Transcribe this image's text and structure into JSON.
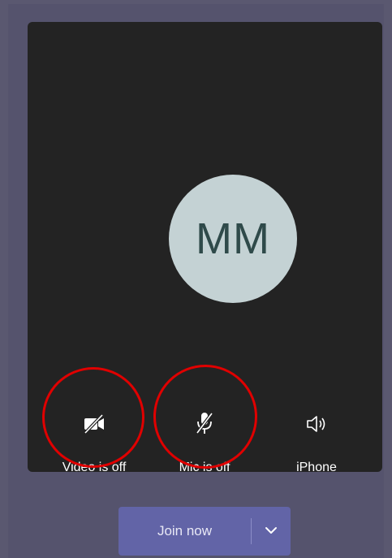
{
  "preview": {
    "avatar_initials": "MM"
  },
  "controls": {
    "video": {
      "label": "Video is off",
      "icon": "video-off-icon"
    },
    "mic": {
      "label": "Mic is off",
      "icon": "mic-off-icon"
    },
    "audio": {
      "label": "iPhone",
      "icon": "speaker-icon"
    }
  },
  "join": {
    "label": "Join now",
    "dropdown_icon": "chevron-down-icon"
  },
  "colors": {
    "background": "#5a5870",
    "panel": "#232323",
    "avatar_bg": "#c4d2d4",
    "accent": "#6264a7",
    "highlight_ring": "#e00000"
  }
}
